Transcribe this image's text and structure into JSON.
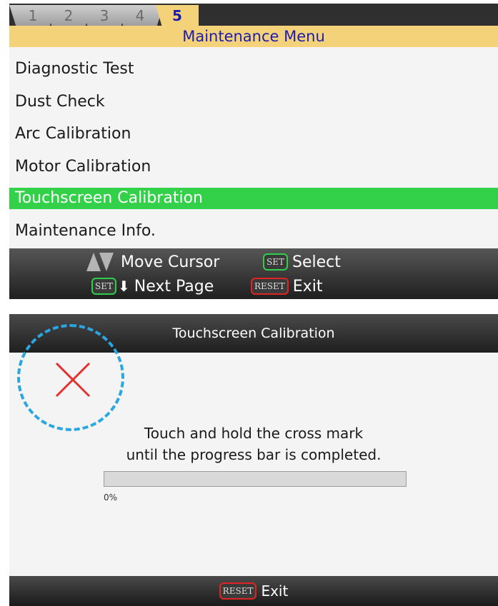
{
  "menu_screen": {
    "tabs": [
      "1",
      "2",
      "3",
      "4",
      "5"
    ],
    "active_tab": "5",
    "title": "Maintenance Menu",
    "items": [
      {
        "label": "Diagnostic Test"
      },
      {
        "label": "Dust Check"
      },
      {
        "label": "Arc Calibration"
      },
      {
        "label": "Motor Calibration"
      },
      {
        "label": "Touchscreen Calibration",
        "selected": true
      },
      {
        "label": "Maintenance Info."
      }
    ],
    "footer": {
      "move_label": "Move Cursor",
      "set_key": "SET",
      "select_label": "Select",
      "next_label": "Next Page",
      "reset_key": "RESET",
      "exit_label": "Exit"
    }
  },
  "calibration_screen": {
    "title": "Touchscreen Calibration",
    "instruction_line1": "Touch and hold the cross mark",
    "instruction_line2": "until the progress bar is completed.",
    "progress_value": 0,
    "progress_label": "0%",
    "footer": {
      "reset_key": "RESET",
      "exit_label": "Exit"
    }
  },
  "colors": {
    "tab_active": "#f4d27a",
    "title_text": "#1c1cb0",
    "selected_row": "#33d14a",
    "target_circle": "#2aa6e0",
    "cross": "#e53030",
    "set_key_border": "#2ed04a",
    "reset_key_border": "#e02424"
  },
  "icons": [
    "up-arrow-icon",
    "down-arrow-icon",
    "cross-mark-icon",
    "down-arrow-small-icon"
  ]
}
